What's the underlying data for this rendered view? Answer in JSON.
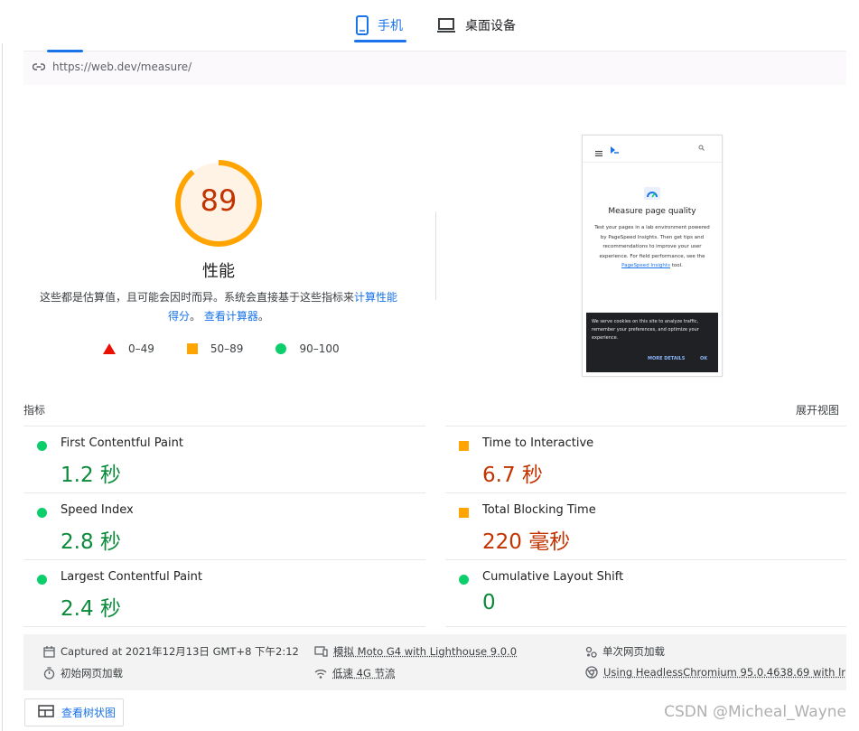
{
  "tabs": [
    {
      "label": "手机",
      "icon": "phone-icon",
      "active": true
    },
    {
      "label": "桌面设备",
      "icon": "laptop-icon",
      "active": false
    }
  ],
  "url": "https://web.dev/measure/",
  "score": {
    "value": "89",
    "fraction": 0.89,
    "title": "性能",
    "desc_prefix": "这些都是估算值，且可能会因时而异。系统会直接基于这些指标来",
    "desc_link1": "计算性能得分",
    "desc_mid": "。",
    "desc_link2": "查看计算器",
    "desc_suffix": "。"
  },
  "legend": [
    {
      "shape": "triangle",
      "label": "0–49"
    },
    {
      "shape": "square",
      "label": "50–89"
    },
    {
      "shape": "circle",
      "label": "90–100"
    }
  ],
  "thumbnail": {
    "title": "Measure page quality",
    "body": "Test your pages in a lab environment powered by PageSpeed Insights. Then get tips and recommendations to improve your user experience. For field performance, see the",
    "link": "PageSpeed Insights",
    "body_end": "tool.",
    "cookie_text": "We serve cookies on this site to analyze traffic, remember your preferences, and optimize your experience.",
    "more_details": "MORE DETAILS",
    "ok": "OK"
  },
  "metrics_header": "指标",
  "expand_view": "展开视图",
  "metrics": [
    {
      "name": "First Contentful Paint",
      "value": "1.2 秒",
      "rating": "good"
    },
    {
      "name": "Time to Interactive",
      "value": "6.7 秒",
      "rating": "average"
    },
    {
      "name": "Speed Index",
      "value": "2.8 秒",
      "rating": "good"
    },
    {
      "name": "Total Blocking Time",
      "value": "220 毫秒",
      "rating": "average"
    },
    {
      "name": "Largest Contentful Paint",
      "value": "2.4 秒",
      "rating": "good"
    },
    {
      "name": "Cumulative Layout Shift",
      "value": "0",
      "rating": "good"
    }
  ],
  "info": {
    "captured": "Captured at 2021年12月13日 GMT+8 下午2:12",
    "device": "模拟 Moto G4 with Lighthouse 9.0.0",
    "session": "单次网页加载",
    "initial": "初始网页加载",
    "throttle": "低速 4G 节流",
    "browser": "Using HeadlessChromium 95.0.4638.69 with lr"
  },
  "treemap_button": "查看树状图",
  "watermark": "CSDN @Micheal_Wayne",
  "colors": {
    "fail": "#eb0f00",
    "average": "#ffa400",
    "pass": "#0cce6b",
    "link": "#1a73e8"
  }
}
